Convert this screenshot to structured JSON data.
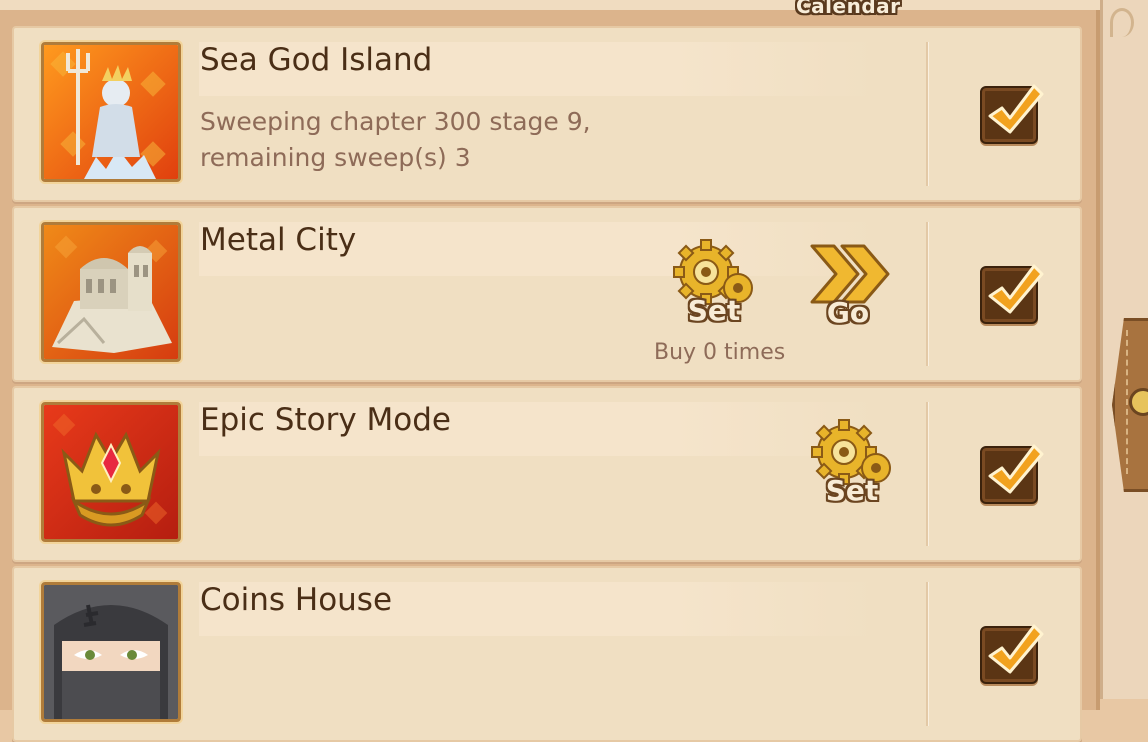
{
  "header": {
    "calendar_label": "Calendar"
  },
  "rows": [
    {
      "title": "Sea God Island",
      "description": [
        "Sweeping chapter 300 stage 9,",
        "remaining sweep(s) 3"
      ],
      "checked": true,
      "icon": "sea-god-statue"
    },
    {
      "title": "Metal City",
      "set_label": "Set",
      "go_label": "Go",
      "buy_text": "Buy 0 times",
      "checked": true,
      "icon": "metal-city-building"
    },
    {
      "title": "Epic Story Mode",
      "set_label": "Set",
      "checked": true,
      "icon": "golden-crown"
    },
    {
      "title": "Coins House",
      "checked": true,
      "icon": "masked-ninja"
    }
  ],
  "colors": {
    "panel": "#f0dfc2",
    "title_text": "#4a2e16",
    "muted_text": "#8e6b58",
    "checkbox": "#5b3514",
    "checkmark": "#f2a21e"
  }
}
